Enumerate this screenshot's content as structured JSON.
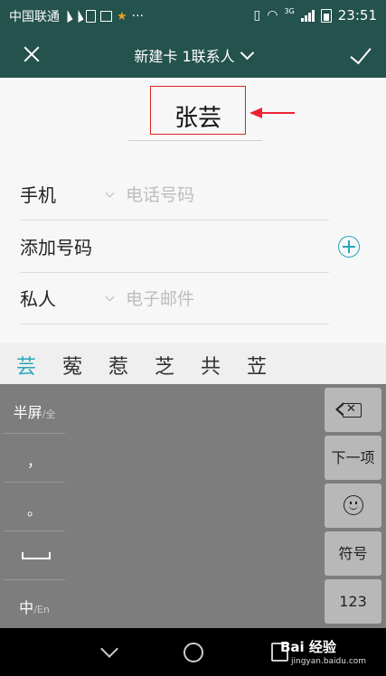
{
  "status_bar": {
    "carrier": "中国联通",
    "more": "···",
    "network_tag": "3G",
    "time": "23:51",
    "icons": [
      "paper-plane-icon",
      "paper-plane-icon",
      "sim-icon",
      "image-icon",
      "star-icon",
      "vibrate-icon",
      "wifi-icon",
      "signal-icon",
      "battery-icon"
    ],
    "accent_star_color": "#e8a020"
  },
  "header": {
    "title": "新建卡 1联系人",
    "close_icon": "close-icon",
    "confirm_icon": "check-icon",
    "bg_color": "#24524d"
  },
  "form": {
    "name_value": "张芸",
    "fields": [
      {
        "label": "手机",
        "placeholder": "电话号码"
      },
      {
        "label": "添加号码"
      },
      {
        "label": "私人",
        "placeholder": "电子邮件"
      }
    ],
    "annotation_color": "#dd2222",
    "accent_color": "#27a6b8"
  },
  "candidates": [
    "芸",
    "蒬",
    "惹",
    "芝",
    "共",
    "苙"
  ],
  "keyboard": {
    "left_keys": [
      {
        "main": "半屏",
        "sub": "/全"
      },
      {
        "main": "，"
      },
      {
        "main": "。"
      },
      {
        "main": "space"
      },
      {
        "main": "中",
        "sub": "/En"
      }
    ],
    "right_keys": {
      "backspace": "backspace-icon",
      "next": "下一项",
      "emoji": "smiley-icon",
      "symbols": "符号",
      "numbers": "123"
    }
  },
  "nav_bar": {
    "icons": [
      "back-icon",
      "home-icon",
      "recent-apps-icon"
    ],
    "watermark": "Bai 经验",
    "watermark_sub": "jingyan.baidu.com"
  }
}
